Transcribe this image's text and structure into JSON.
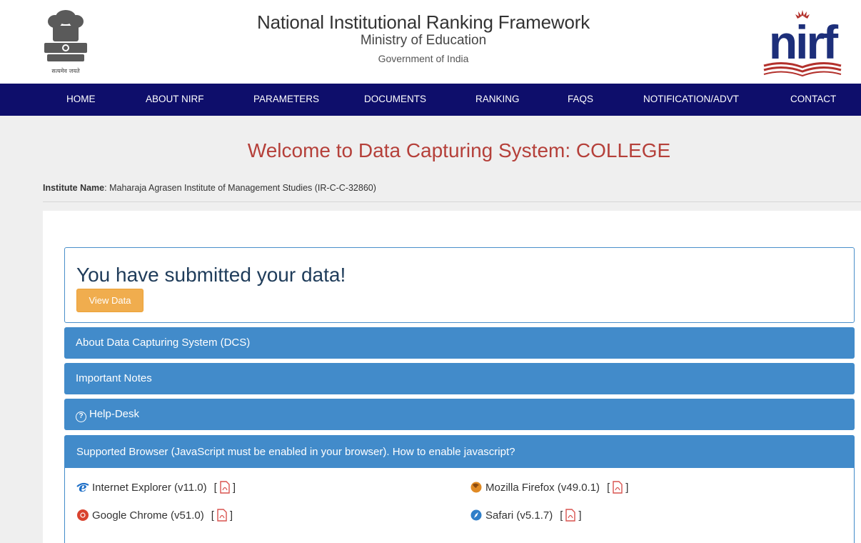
{
  "header": {
    "title": "National Institutional Ranking Framework",
    "subtitle1": "Ministry of Education",
    "subtitle2": "Government of India",
    "emblem_motto": "सत्यमेव जयते",
    "logo_text": "nirf"
  },
  "nav": {
    "items": [
      "HOME",
      "ABOUT NIRF",
      "PARAMETERS",
      "DOCUMENTS",
      "RANKING",
      "FAQS",
      "NOTIFICATION/ADVT",
      "CONTACT"
    ]
  },
  "page": {
    "welcome": "Welcome to Data Capturing System: COLLEGE",
    "institute_label": "Institute Name",
    "institute_value": ": Maharaja Agrasen Institute of Management Studies (IR-C-C-32860)"
  },
  "status": {
    "message": "You have submitted your data!",
    "view_button": "View Data"
  },
  "accordion": {
    "about": "About Data Capturing System (DCS)",
    "notes": "Important Notes",
    "helpdesk": "Help-Desk"
  },
  "browsers": {
    "heading": "Supported Browser (JavaScript must be enabled in your browser). How to enable javascript?",
    "ie": "Internet Explorer (v11.0)",
    "firefox": "Mozilla Firefox (v49.0.1)",
    "chrome": "Google Chrome (v51.0)",
    "safari": "Safari (v5.1.7)"
  },
  "colors": {
    "nav_bg": "#0e0e6b",
    "welcome": "#b5403a",
    "panel_blue": "#428bca",
    "button_orange": "#f0ad4e"
  }
}
